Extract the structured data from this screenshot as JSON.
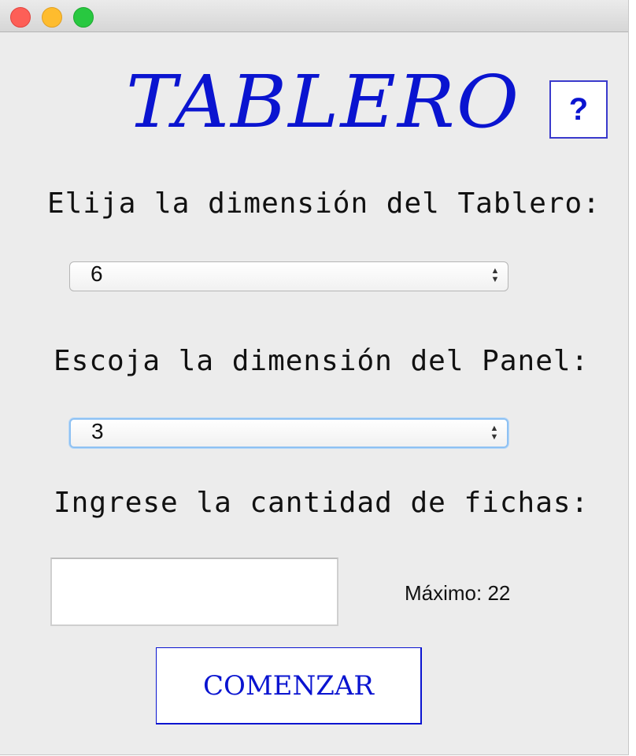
{
  "window": {
    "title_art": "TABLERO",
    "help_label": "?"
  },
  "board": {
    "label": "Elija la dimensión del Tablero:",
    "value": "6"
  },
  "panel": {
    "label": "Escoja la dimensión del Panel:",
    "value": "3"
  },
  "chips": {
    "label": "Ingrese la cantidad de fichas:",
    "value": "",
    "max_text": "Máximo: 22"
  },
  "actions": {
    "start_label": "COMENZAR"
  },
  "colors": {
    "accent": "#0a14d0",
    "window_bg": "#ececec",
    "focus_ring": "#8ec1f3"
  }
}
